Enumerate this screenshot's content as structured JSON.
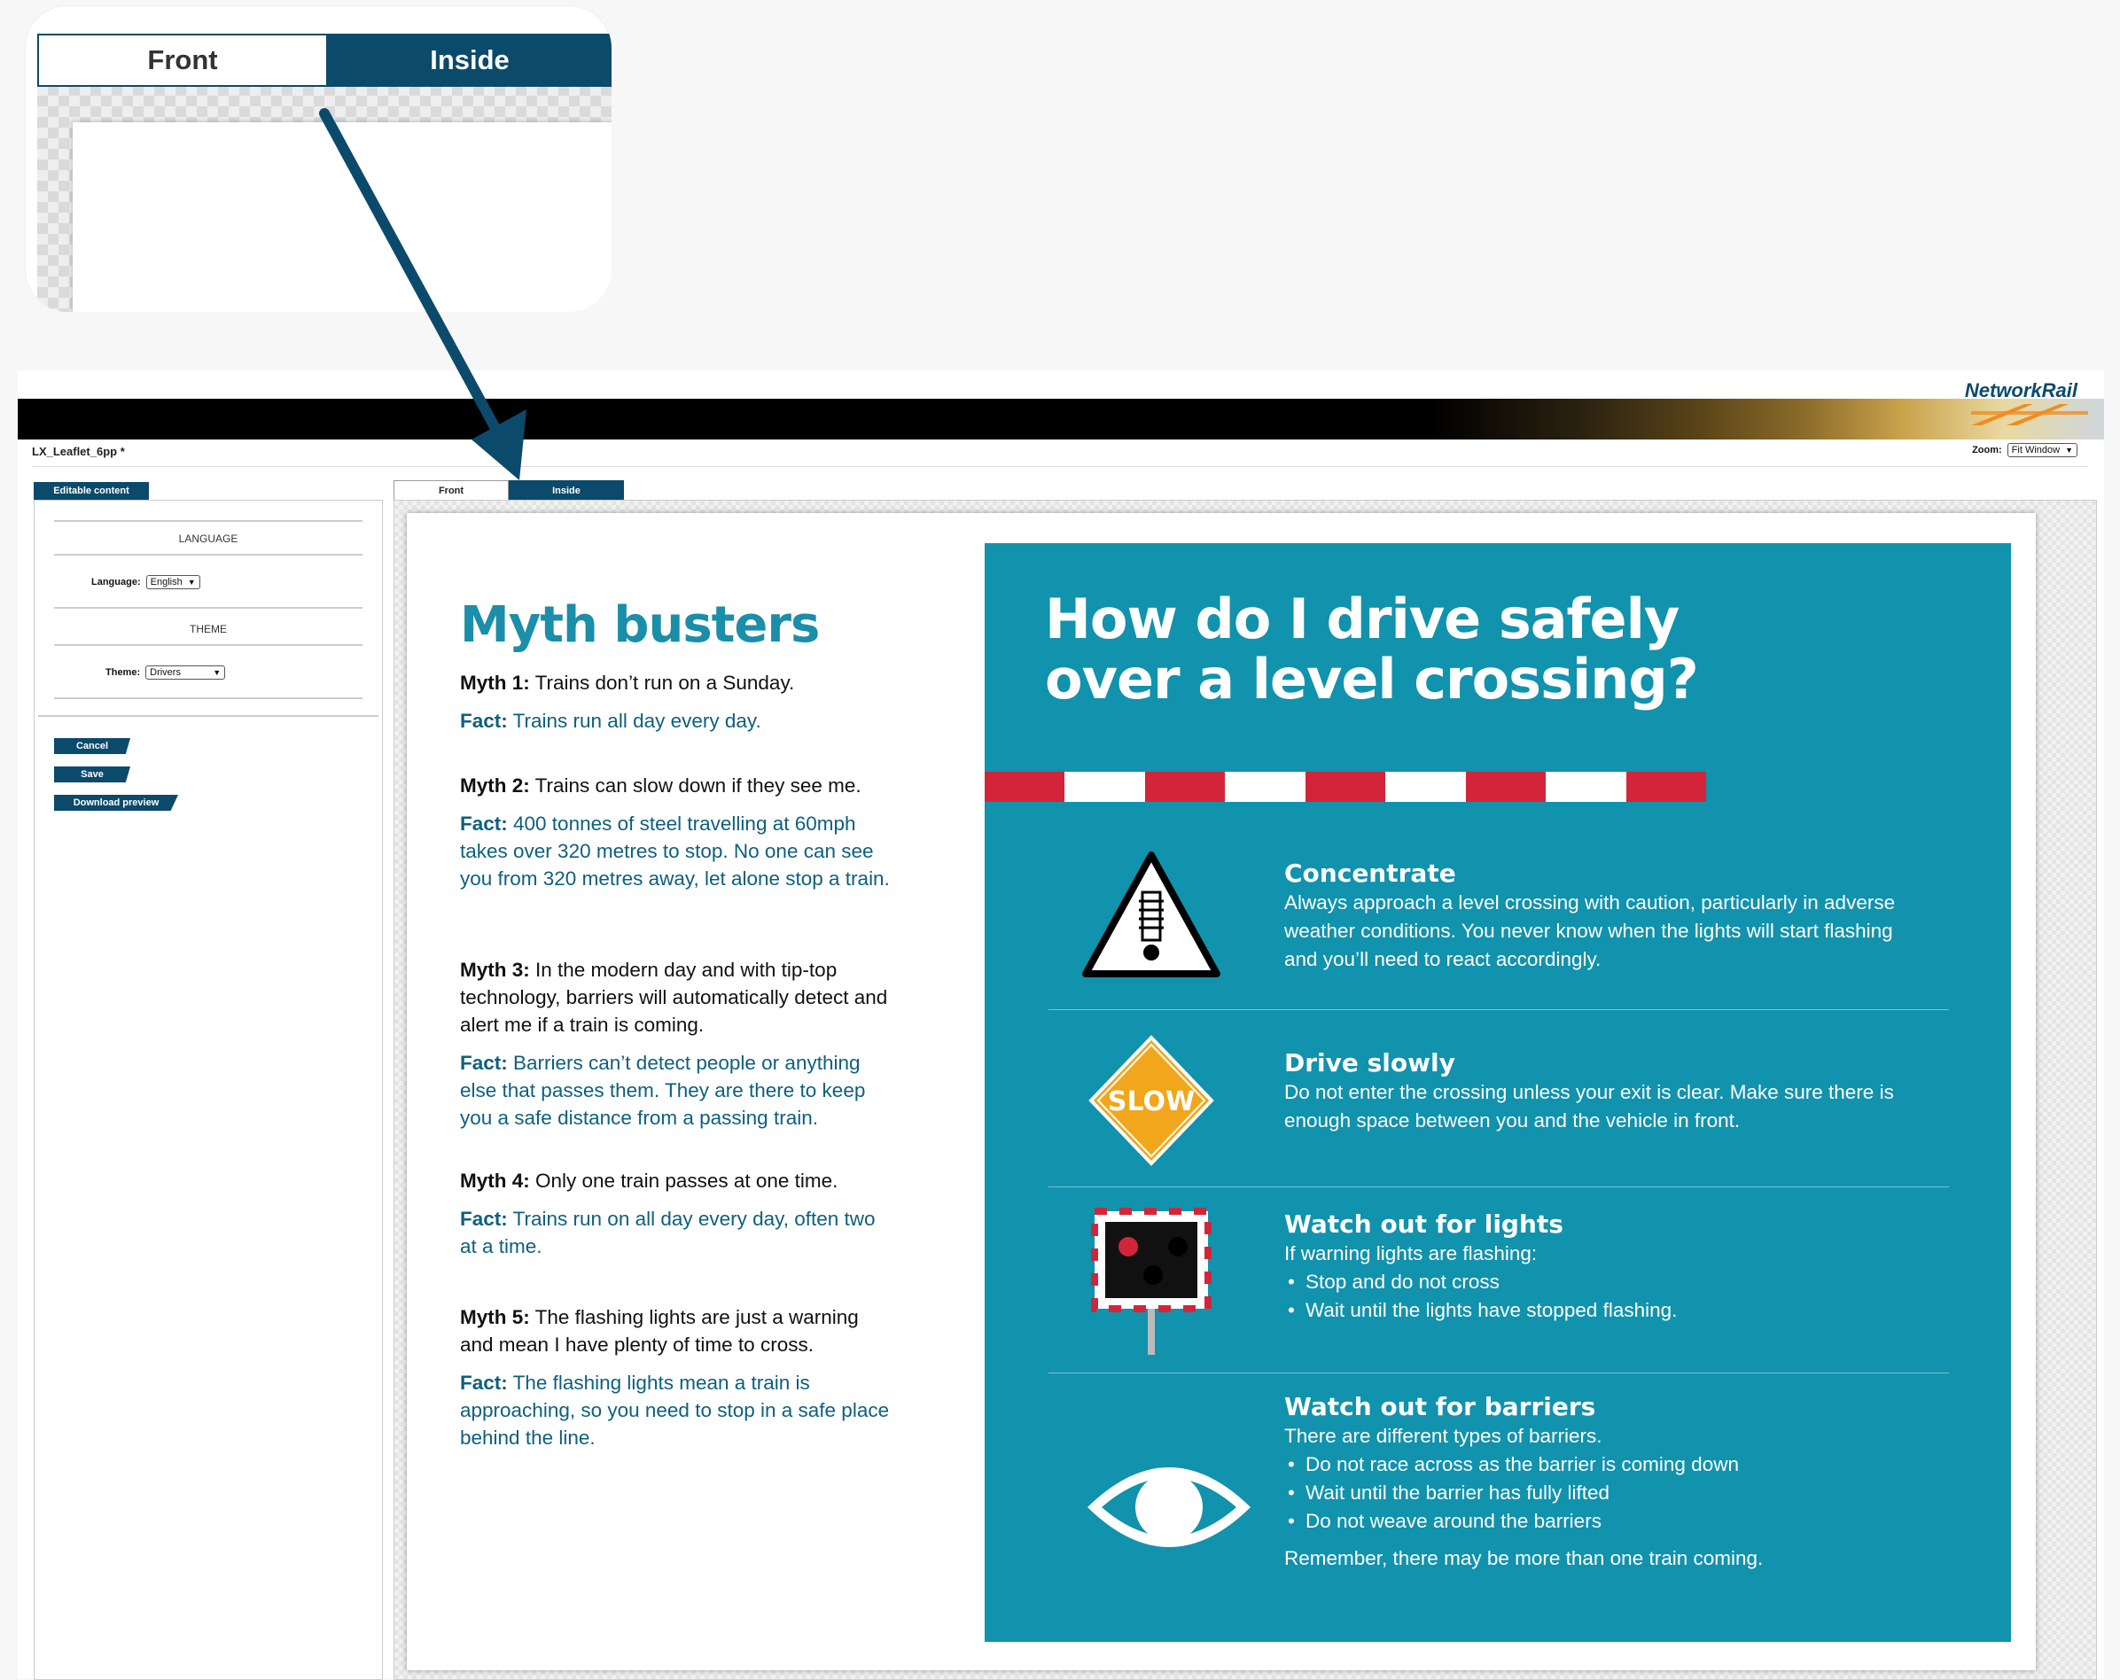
{
  "callout": {
    "tab_front": "Front",
    "tab_inside": "Inside"
  },
  "app": {
    "brand": "NetworkRail",
    "doc_title": "LX_Leaflet_6pp *",
    "zoom_label": "Zoom:",
    "zoom_value": "Fit Window"
  },
  "left_panel": {
    "tab_label": "Editable content",
    "language_heading": "LANGUAGE",
    "language_label": "Language:",
    "language_value": "English",
    "theme_heading": "THEME",
    "theme_label": "Theme:",
    "theme_value": "Drivers",
    "buttons": {
      "cancel": "Cancel",
      "save": "Save",
      "download": "Download preview"
    }
  },
  "preview": {
    "tab_front": "Front",
    "tab_inside": "Inside"
  },
  "leaflet": {
    "myth_title": "Myth busters",
    "myths": [
      {
        "label": "Myth 1:",
        "text": " Trains don’t run on a Sunday.",
        "fact_label": "Fact:",
        "fact": " Trains run all day every day."
      },
      {
        "label": "Myth 2:",
        "text": " Trains can slow down if they see me.",
        "fact_label": "Fact:",
        "fact": " 400 tonnes of steel travelling at 60mph takes over 320 metres to stop. No one can see you from 320 metres away, let alone stop a train."
      },
      {
        "label": "Myth 3:",
        "text": " In the modern day and with tip-top technology, barriers will automatically detect and alert me if a train is coming.",
        "fact_label": "Fact:",
        "fact": " Barriers can’t detect people or anything else that passes them. They are there to keep you a safe distance from a passing train."
      },
      {
        "label": "Myth 4:",
        "text": " Only one train passes at one time.",
        "fact_label": "Fact:",
        "fact": " Trains run on all day every day, often two at a time."
      },
      {
        "label": "Myth 5:",
        "text": " The flashing lights are just a warning and mean I have plenty of time to cross.",
        "fact_label": "Fact:",
        "fact": " The flashing lights mean a train is approaching, so you need to stop in a safe place behind the line."
      }
    ],
    "drive_title": "How do I drive safely over a level crossing?",
    "sections": [
      {
        "heading": "Concentrate",
        "text": "Always approach a level crossing with caution, particularly in adverse weather conditions. You never know when the lights will start flashing and you’ll need to react accordingly.",
        "icon": "warning-sign-icon"
      },
      {
        "heading": "Drive slowly",
        "text": "Do not enter the crossing unless your exit is clear. Make sure there is enough space between you and the vehicle in front.",
        "icon": "slow-sign-icon",
        "sign_text": "SLOW"
      },
      {
        "heading": "Watch out for lights",
        "text": "If warning lights are flashing:",
        "bullets": [
          "Stop and do not cross",
          "Wait until the lights have stopped flashing."
        ],
        "icon": "warning-lights-icon"
      },
      {
        "heading": "Watch out for barriers",
        "text": "There are different types of barriers.",
        "bullets": [
          "Do not race across as the barrier is coming down",
          "Wait until the barrier has fully lifted",
          "Do not weave around the barriers"
        ],
        "extra": "Remember, there may be more than one train coming.",
        "icon": "eye-icon"
      }
    ]
  },
  "colors": {
    "navy": "#0b4a6b",
    "teal": "#1192ad",
    "myth_title": "#1b8ea9",
    "fact_text": "#0d5f7e",
    "stripe_red": "#d3253a",
    "slow_amber": "#f2a61c"
  }
}
